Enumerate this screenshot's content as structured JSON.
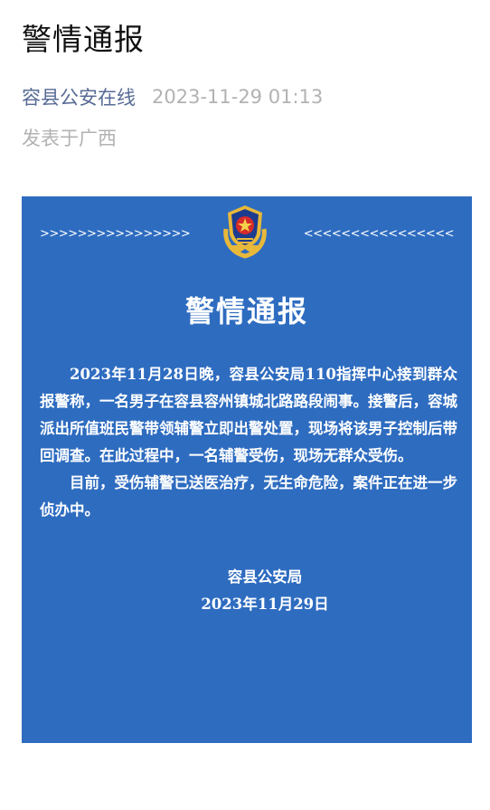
{
  "article": {
    "title": "警情通报",
    "account_name": "容县公安在线",
    "publish_time": "2023-11-29 01:13",
    "location": "发表于广西"
  },
  "notice": {
    "arrows_left": ">>>>>>>>>>>>>>>>",
    "arrows_right": "<<<<<<<<<<<<<<<<",
    "emblem": "police-emblem-icon",
    "title": "警情通报",
    "paragraph_1": "2023年11月28日晚，容县公安局110指挥中心接到群众报警称，一名男子在容县容州镇城北路路段闹事。接警后，容城派出所值班民警带领辅警立即出警处置，现场将该男子控制后带回调查。在此过程中，一名辅警受伤，现场无群众受伤。",
    "paragraph_2": "目前，受伤辅警已送医治疗，无生命危险，案件正在进一步侦办中。",
    "signature_org": "容县公安局",
    "signature_date": "2023年11月29日"
  },
  "colors": {
    "background_blue": "#2e6cc0",
    "link_blue": "#576b95",
    "meta_gray": "#b2b2b2"
  }
}
